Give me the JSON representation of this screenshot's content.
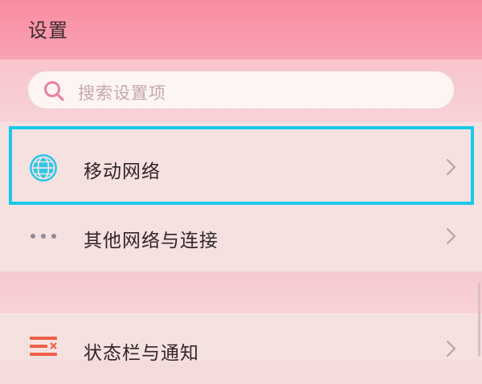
{
  "header": {
    "title": "设置"
  },
  "search": {
    "placeholder": "搜索设置项",
    "icon": "search-icon",
    "icon_color": "#e8849a"
  },
  "settings_items": [
    {
      "label": "移动网络",
      "icon": "globe-icon",
      "icon_color": "#2ec7e8",
      "highlighted": true
    },
    {
      "label": "其他网络与连接",
      "icon": "more-dots-icon",
      "icon_color": "#8e8a95"
    },
    {
      "label": "状态栏与通知",
      "icon": "statusbar-notification-icon",
      "icon_color": "#f0604a"
    }
  ],
  "colors": {
    "header_bg": "#f98da1",
    "list_bg": "#f6e1e1",
    "highlight_border": "#18c8e8",
    "text": "#2e2628",
    "chevron": "#b4a4a8"
  }
}
